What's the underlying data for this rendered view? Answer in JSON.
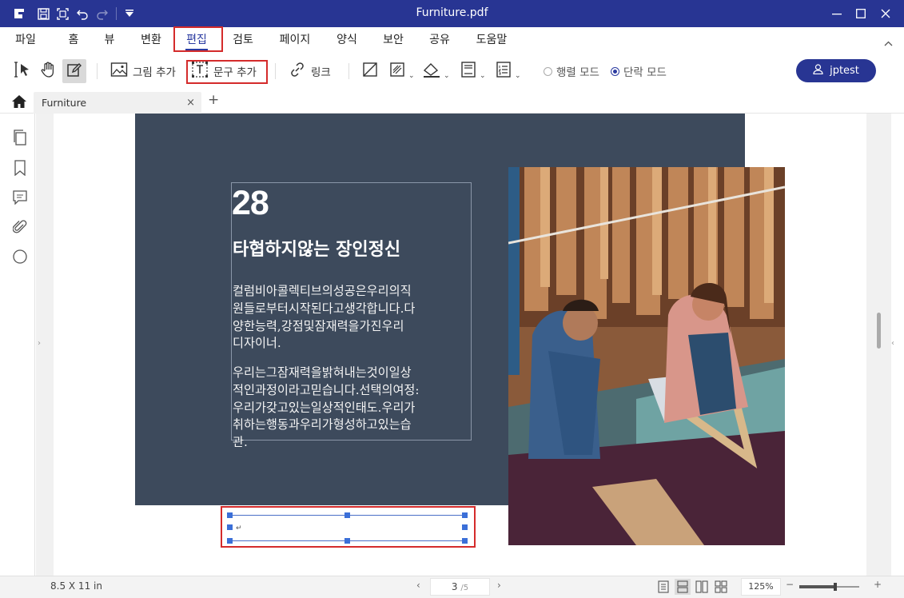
{
  "window": {
    "title": "Furniture.pdf"
  },
  "menu": {
    "items": [
      {
        "label": "파일"
      },
      {
        "label": "홈"
      },
      {
        "label": "뷰"
      },
      {
        "label": "변환"
      },
      {
        "label": "편집"
      },
      {
        "label": "검토"
      },
      {
        "label": "페이지"
      },
      {
        "label": "양식"
      },
      {
        "label": "보안"
      },
      {
        "label": "공유"
      },
      {
        "label": "도움말"
      }
    ],
    "active": "편집"
  },
  "toolbar": {
    "add_image": "그림 추가",
    "add_text": "문구 추가",
    "link": "링크",
    "line_mode": "행렬 모드",
    "paragraph_mode": "단락 모드",
    "selected_mode": "단락 모드"
  },
  "user": {
    "name": "jptest"
  },
  "tabs": [
    {
      "label": "Furniture"
    }
  ],
  "document": {
    "number": "28",
    "heading": "타협하지않는 장인정신",
    "para1_lines": [
      "컬럼비아콜렉티브의성공은우리의직",
      "원들로부터시작된다고생각합니다.다",
      "양한능력,강점및잠재력을가진우리",
      "디자이너."
    ],
    "para2_lines": [
      "우리는그잠재력을밝혀내는것이일상",
      "적인과정이라고믿습니다.선택의여정:",
      "우리가갖고있는일상적인태도.우리가",
      "취하는행동과우리가형성하고있는습",
      "관."
    ],
    "newline_mark": "↵"
  },
  "status": {
    "page_size": "8.5 X 11 in",
    "current_page": "3",
    "total_pages": "/5",
    "zoom": "125%",
    "zoom_fraction": 0.6
  },
  "colors": {
    "brand": "#283593",
    "highlight_box": "#d42b2b",
    "panel": "#3d4a5c",
    "handle": "#3b6fd8"
  }
}
